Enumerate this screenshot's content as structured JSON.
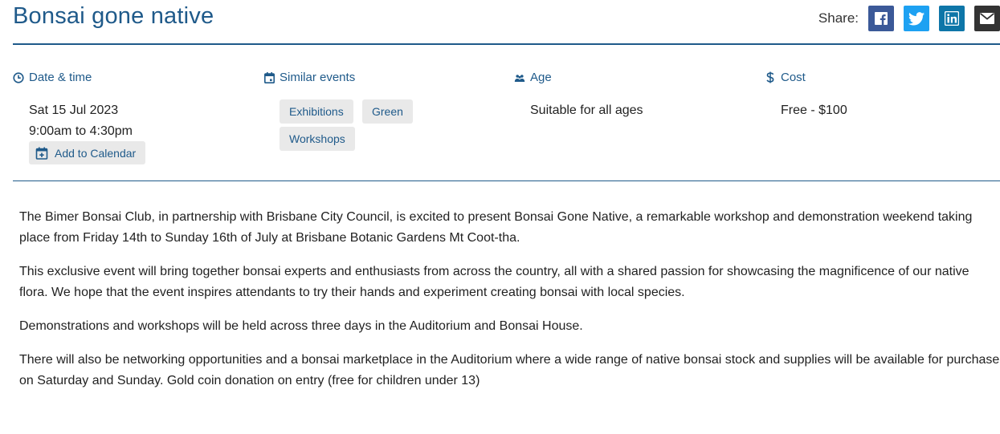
{
  "event": {
    "title": "Bonsai gone native"
  },
  "share": {
    "label": "Share:",
    "buttons": [
      {
        "name": "facebook-icon",
        "color": "#3b5998"
      },
      {
        "name": "twitter-icon",
        "color": "#1da1f2"
      },
      {
        "name": "linkedin-icon",
        "color": "#0e76a8"
      },
      {
        "name": "email-icon",
        "color": "#333333"
      }
    ]
  },
  "info": {
    "date_time": {
      "heading": "Date & time",
      "icon": "clock-icon",
      "date": "Sat 15 Jul 2023",
      "time": "9:00am to 4:30pm",
      "calendar_button": "Add to Calendar",
      "calendar_icon": "calendar-add-icon"
    },
    "similar_events": {
      "heading": "Similar events",
      "icon": "calendar-icon",
      "tags": [
        "Exhibitions",
        "Green",
        "Workshops"
      ]
    },
    "age": {
      "heading": "Age",
      "icon": "people-icon",
      "value": "Suitable for all ages"
    },
    "cost": {
      "heading": "Cost",
      "icon": "dollar-icon",
      "value": "Free - $100"
    }
  },
  "description": {
    "paragraphs": [
      "The Bimer Bonsai Club, in partnership with Brisbane City Council, is excited to present Bonsai Gone Native, a remarkable workshop and demonstration weekend taking place from Friday 14th to Sunday 16th of July at Brisbane Botanic Gardens Mt Coot-tha.",
      "This exclusive event will bring together bonsai experts and enthusiasts from across the country, all with a shared passion for showcasing the magnificence of our native flora. We hope that the event inspires attendants to try their hands and experiment creating bonsai with local species.",
      "Demonstrations and workshops will be held across three days in the Auditorium and Bonsai House.",
      "There will also be networking opportunities and a bonsai marketplace in the Auditorium where a wide range of native bonsai stock and supplies will be available for purchase on Saturday and Sunday. Gold coin donation on entry (free for children under 13)"
    ]
  },
  "colors": {
    "accent": "#1f5a8a",
    "tag_bg": "#e9e9e9"
  }
}
